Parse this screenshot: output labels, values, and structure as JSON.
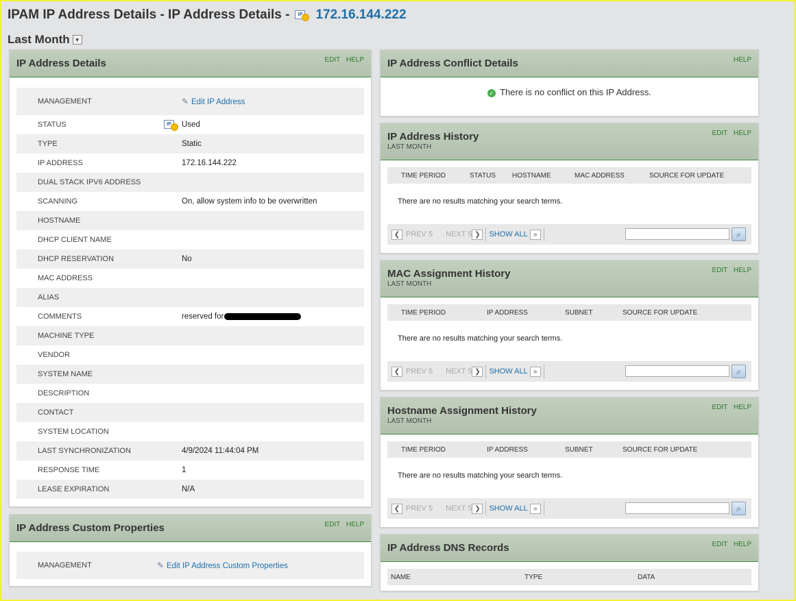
{
  "header": {
    "title": "IPAM IP Address Details - IP Address Details -",
    "ip": "172.16.144.222",
    "ip_icon_label": "IP",
    "period": "Last Month"
  },
  "details": {
    "title": "IP Address Details",
    "edit": "EDIT",
    "help": "HELP",
    "management_label": "MANAGEMENT",
    "management_link": "Edit IP Address",
    "rows": [
      {
        "label": "STATUS",
        "value": "Used"
      },
      {
        "label": "TYPE",
        "value": "Static"
      },
      {
        "label": "IP ADDRESS",
        "value": "172.16.144.222"
      },
      {
        "label": "DUAL STACK IPV6 ADDRESS",
        "value": ""
      },
      {
        "label": "SCANNING",
        "value": "On, allow system info to be overwritten"
      },
      {
        "label": "HOSTNAME",
        "value": ""
      },
      {
        "label": "DHCP CLIENT NAME",
        "value": ""
      },
      {
        "label": "DHCP RESERVATION",
        "value": "No"
      },
      {
        "label": "MAC ADDRESS",
        "value": ""
      },
      {
        "label": "ALIAS",
        "value": ""
      },
      {
        "label": "COMMENTS",
        "value": "reserved for"
      },
      {
        "label": "MACHINE TYPE",
        "value": ""
      },
      {
        "label": "VENDOR",
        "value": ""
      },
      {
        "label": "SYSTEM NAME",
        "value": ""
      },
      {
        "label": "DESCRIPTION",
        "value": ""
      },
      {
        "label": "CONTACT",
        "value": ""
      },
      {
        "label": "SYSTEM LOCATION",
        "value": ""
      },
      {
        "label": "LAST SYNCHRONIZATION",
        "value": "4/9/2024 11:44:04 PM"
      },
      {
        "label": "RESPONSE TIME",
        "value": "1"
      },
      {
        "label": "LEASE EXPIRATION",
        "value": "N/A"
      }
    ]
  },
  "custom": {
    "title": "IP Address Custom Properties",
    "edit": "EDIT",
    "help": "HELP",
    "management_label": "MANAGEMENT",
    "link": "Edit IP Address Custom Properties"
  },
  "conflict": {
    "title": "IP Address Conflict Details",
    "help": "HELP",
    "message": "There is no conflict on this IP Address."
  },
  "history": {
    "title": "IP Address History",
    "sub": "LAST MONTH",
    "edit": "EDIT",
    "help": "HELP",
    "columns": [
      "TIME PERIOD",
      "STATUS",
      "HOSTNAME",
      "MAC ADDRESS",
      "SOURCE FOR UPDATE"
    ],
    "empty": "There are no results matching your search terms."
  },
  "mac": {
    "title": "MAC Assignment History",
    "sub": "LAST MONTH",
    "edit": "EDIT",
    "help": "HELP",
    "columns": [
      "TIME PERIOD",
      "IP ADDRESS",
      "SUBNET",
      "SOURCE FOR UPDATE"
    ],
    "empty": "There are no results matching your search terms."
  },
  "hostname": {
    "title": "Hostname Assignment History",
    "sub": "LAST MONTH",
    "edit": "EDIT",
    "help": "HELP",
    "columns": [
      "TIME PERIOD",
      "IP ADDRESS",
      "SUBNET",
      "SOURCE FOR UPDATE"
    ],
    "empty": "There are no results matching your search terms."
  },
  "dns": {
    "title": "IP Address DNS Records",
    "edit": "EDIT",
    "help": "HELP",
    "columns": [
      "NAME",
      "TYPE",
      "DATA"
    ]
  },
  "pager": {
    "prev": "PREV 5",
    "next": "NEXT 5",
    "show_all": "SHOW ALL"
  },
  "colors": {
    "accent": "#1e6fa8",
    "panel_header": "#b8c7b4",
    "action_green": "#2d7a2d",
    "status_dot": "#f5bb0d"
  }
}
